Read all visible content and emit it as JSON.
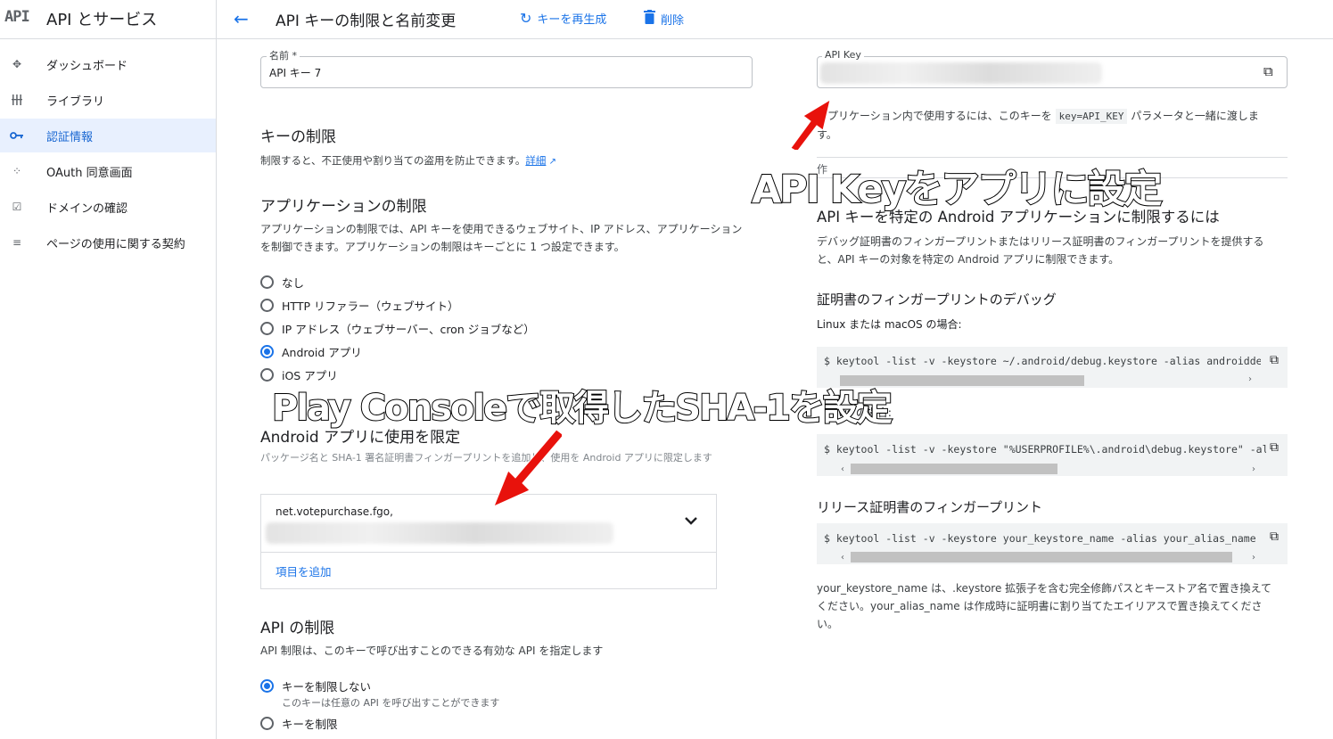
{
  "app": {
    "logo": "API",
    "title": "API とサービス"
  },
  "sidebar": {
    "items": [
      {
        "label": "ダッシュボード",
        "icon": "dashboard-icon"
      },
      {
        "label": "ライブラリ",
        "icon": "library-icon"
      },
      {
        "label": "認証情報",
        "icon": "key-icon",
        "active": true
      },
      {
        "label": "OAuth 同意画面",
        "icon": "oauth-icon"
      },
      {
        "label": "ドメインの確認",
        "icon": "checkbox-icon"
      },
      {
        "label": "ページの使用に関する契約",
        "icon": "settings-list-icon"
      }
    ]
  },
  "header": {
    "title": "API キーの制限と名前変更",
    "regenerate_label": "キーを再生成",
    "delete_label": "削除"
  },
  "name_field": {
    "label": "名前 *",
    "value": "API キー 7"
  },
  "key_restrictions": {
    "title": "キーの制限",
    "desc": "制限すると、不正使用や割り当ての盗用を防止できます。",
    "link": "詳細"
  },
  "app_restrictions": {
    "title": "アプリケーションの制限",
    "desc": "アプリケーションの制限では、API キーを使用できるウェブサイト、IP アドレス、アプリケーションを制御できます。アプリケーションの制限はキーごとに 1 つ設定できます。",
    "options": [
      {
        "label": "なし",
        "selected": false
      },
      {
        "label": "HTTP リファラー（ウェブサイト）",
        "selected": false
      },
      {
        "label": "IP アドレス（ウェブサーバー、cron ジョブなど）",
        "selected": false
      },
      {
        "label": "Android アプリ",
        "selected": true
      },
      {
        "label": "iOS アプリ",
        "selected": false
      }
    ]
  },
  "android_limit": {
    "title": "Android アプリに使用を限定",
    "desc": "パッケージ名と SHA-1 署名証明書フィンガープリントを追加し、使用を Android アプリに限定します",
    "package": "net.votepurchase.fgo,",
    "add_item": "項目を追加"
  },
  "api_restrictions": {
    "title": "API の制限",
    "desc": "API 制限は、このキーで呼び出すことのできる有効な API を指定します",
    "options": [
      {
        "label": "キーを制限しない",
        "sub": "このキーは任意の API を呼び出すことができます",
        "selected": true
      },
      {
        "label": "キーを制限",
        "selected": false
      }
    ]
  },
  "api_key": {
    "label": "API Key",
    "usage": "アプリケーション内で使用するには、このキーを",
    "param": "key=API_KEY",
    "usage2": "パラメータと一緒に渡します。",
    "created_partial": "作"
  },
  "android_help": {
    "title": "API キーを特定の Android アプリケーションに制限するには",
    "desc": "デバッグ証明書のフィンガープリントまたはリリース証明書のフィンガープリントを提供すると、API キーの対象を特定の Android アプリに制限できます。",
    "debug_title": "証明書のフィンガープリントのデバッグ",
    "linux_label": "Linux または macOS の場合:",
    "cmd_linux": "$ keytool -list -v -keystore ~/.android/debug.keystore -alias androiddebugkey",
    "windows_label": "ws の場合:",
    "cmd_windows": "$ keytool -list -v -keystore \"%USERPROFILE%\\.android\\debug.keystore\" -alias androiddebugkey",
    "release_title": "リリース証明書のフィンガープリント",
    "cmd_release": "$ keytool -list -v -keystore your_keystore_name -alias your_alias_name",
    "release_note": "your_keystore_name は、.keystore 拡張子を含む完全修飾パスとキーストア名で置き換えてください。your_alias_name は作成時に証明書に割り当てたエイリアスで置き換えてください。"
  },
  "annotations": {
    "api_key": "API Keyをアプリに設定",
    "sha1": "Play Consoleで取得したSHA-1を設定"
  },
  "colors": {
    "accent": "#1a73e8",
    "arrow": "#e8120c",
    "active_bg": "#e8f0fe"
  }
}
